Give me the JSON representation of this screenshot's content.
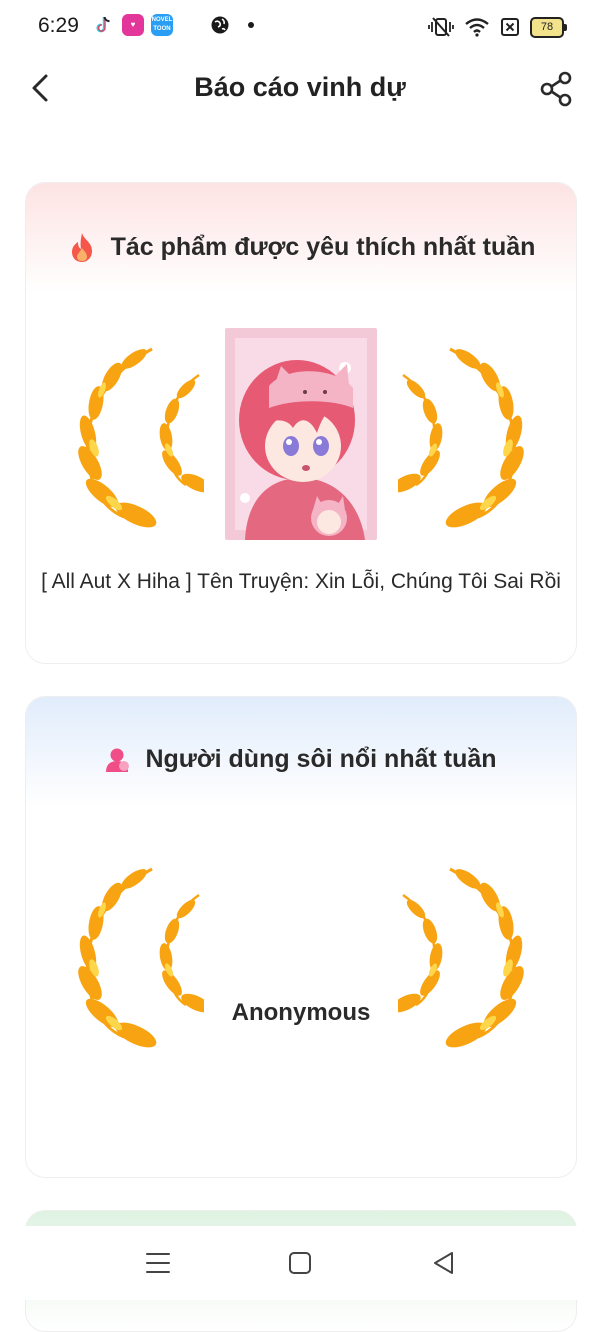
{
  "status_bar": {
    "time": "6:29",
    "battery": "78",
    "icons": [
      "tiktok-icon",
      "app-icon",
      "novel-toon-icon",
      "globe-icon",
      "dot-icon",
      "vibrate-icon",
      "wifi-icon",
      "sim-off-icon",
      "battery-icon"
    ]
  },
  "header": {
    "title": "Báo cáo vinh dự",
    "back_icon": "chevron-left-icon",
    "share_icon": "share-icon"
  },
  "sections": [
    {
      "title": "Tác phẩm được yêu thích nhất tuần",
      "icon": "fire-icon",
      "item_title": "[ All Aut X Hiha ] Tên Truyện: Xin Lỗi, Chúng Tôi Sai Rồi",
      "gradient_color": "#fde3e3"
    },
    {
      "title": "Người dùng sôi nổi nhất tuần",
      "icon": "user-icon",
      "user_name": "Anonymous",
      "gradient_color": "#e1ecfb"
    }
  ],
  "colors": {
    "laurel": "#f8a412",
    "laurel_light": "#fdd64a",
    "fire": "#f5574a",
    "user": "#ef4f86",
    "next_card": "#dff3e2"
  },
  "nav_bar": {
    "icons": [
      "menu-icon",
      "home-square-icon",
      "back-triangle-icon"
    ]
  }
}
